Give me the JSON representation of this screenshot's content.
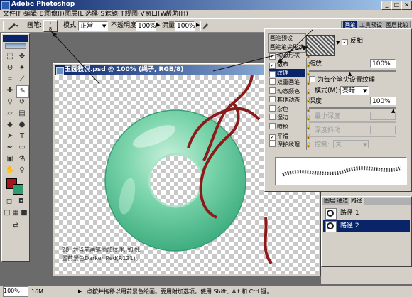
{
  "app": {
    "title": "Adobe Photoshop"
  },
  "menu": {
    "items": [
      "文件(F)",
      "编辑(E)",
      "图像(I)",
      "图层(L)",
      "选择(S)",
      "滤镜(T)",
      "视图(V)",
      "窗口(W)",
      "帮助(H)"
    ]
  },
  "options": {
    "brush_label": "画笔:",
    "brush_size": "8",
    "mode_label": "模式:",
    "mode_value": "正常",
    "opacity_label": "不透明度:",
    "opacity_value": "100%",
    "flow_label": "流量:",
    "flow_value": "100%",
    "right_tabs": [
      "画笔",
      "工具预设",
      "图层比较"
    ]
  },
  "document": {
    "title": "玉圆教程.psd @ 100% (绳子, RGB/8)",
    "annotation_line1": "28. 为当前画笔添加纹理, 如图,",
    "annotation_line2": "置前景色Darker Red(R121)。"
  },
  "brush_palette": {
    "items": [
      {
        "label": "画笔预设",
        "checkbox": false,
        "checked": false,
        "selected": false,
        "disabled": false
      },
      {
        "label": "画笔笔尖形状",
        "checkbox": false,
        "checked": false,
        "selected": false,
        "disabled": false
      },
      {
        "label": "动态形状",
        "checkbox": true,
        "checked": true,
        "selected": false,
        "disabled": false
      },
      {
        "label": "散布",
        "checkbox": true,
        "checked": true,
        "selected": false,
        "disabled": false
      },
      {
        "label": "纹理",
        "checkbox": true,
        "checked": true,
        "selected": true,
        "disabled": false
      },
      {
        "label": "双重画笔",
        "checkbox": true,
        "checked": false,
        "selected": false,
        "disabled": false
      },
      {
        "label": "动态颜色",
        "checkbox": true,
        "checked": false,
        "selected": false,
        "disabled": false
      },
      {
        "label": "其他动态",
        "checkbox": true,
        "checked": false,
        "selected": false,
        "disabled": false
      },
      {
        "label": "杂色",
        "checkbox": true,
        "checked": false,
        "selected": false,
        "disabled": false
      },
      {
        "label": "湿边",
        "checkbox": true,
        "checked": false,
        "selected": false,
        "disabled": false
      },
      {
        "label": "喷枪",
        "checkbox": true,
        "checked": false,
        "selected": false,
        "disabled": false
      },
      {
        "label": "平滑",
        "checkbox": true,
        "checked": true,
        "selected": false,
        "disabled": false
      },
      {
        "label": "保护纹理",
        "checkbox": true,
        "checked": false,
        "selected": false,
        "disabled": false
      }
    ],
    "invert_label": "反相",
    "scale_label": "缩放",
    "scale_value": "100%",
    "per_tip_label": "为每个笔尖设置纹理",
    "mode_label": "模式(M):",
    "mode_value": "亮暗",
    "depth_label": "深度",
    "depth_value": "100%",
    "min_depth_label": "最小深度",
    "depth_jitter_label": "深度抖动",
    "control_label": "控制:",
    "control_value": "关"
  },
  "paths_palette": {
    "tabs": [
      "图层",
      "通道",
      "路径"
    ],
    "items": [
      {
        "name": "路径 1",
        "selected": false
      },
      {
        "name": "路径 2",
        "selected": true
      }
    ]
  },
  "status": {
    "zoom": "100%",
    "doc_size": "16M",
    "hint": "点按并拖移以用前景色绘画。要用附加选项，使用 Shift、Alt 和 Ctrl 键。"
  },
  "colors": {
    "foreground": "#a8141a",
    "background": "#2e9e72",
    "title_bar": "#0a246a",
    "jade": "#5fc89a"
  }
}
